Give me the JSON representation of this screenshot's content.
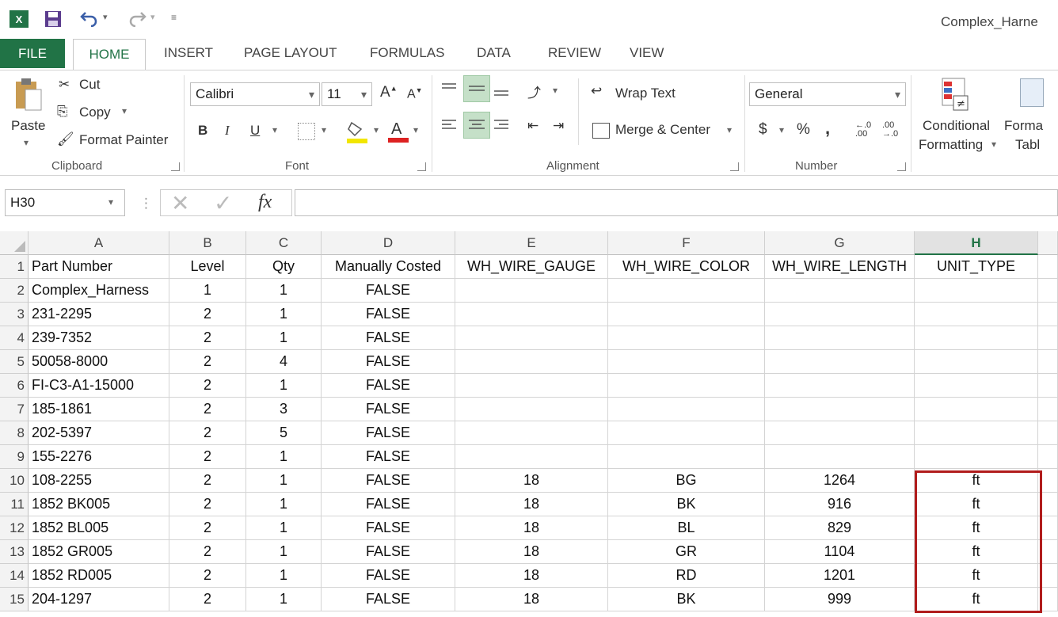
{
  "window": {
    "title": "Complex_Harne"
  },
  "quick_access": {
    "undo_icon": "undo-icon",
    "redo_icon": "redo-icon",
    "customize_icon": "customize-icon"
  },
  "tabs": [
    "FILE",
    "HOME",
    "INSERT",
    "PAGE LAYOUT",
    "FORMULAS",
    "DATA",
    "REVIEW",
    "VIEW"
  ],
  "ribbon": {
    "clipboard": {
      "paste": "Paste",
      "cut": "Cut",
      "copy": "Copy",
      "format_painter": "Format Painter",
      "label": "Clipboard"
    },
    "font": {
      "name": "Calibri",
      "size": "11",
      "bold": "B",
      "italic": "I",
      "underline": "U",
      "label": "Font"
    },
    "alignment": {
      "wrap_text": "Wrap Text",
      "merge_center": "Merge & Center",
      "label": "Alignment"
    },
    "number": {
      "format": "General",
      "currency": "$",
      "percent": "%",
      "comma": ",",
      "label": "Number"
    },
    "styles": {
      "conditional_line1": "Conditional",
      "conditional_line2": "Formatting",
      "format_line1": "Forma",
      "format_line2": "Tabl"
    }
  },
  "formula_bar": {
    "name_box": "H30",
    "fx": "fx",
    "value": ""
  },
  "columns": [
    "A",
    "B",
    "C",
    "D",
    "E",
    "F",
    "G",
    "H"
  ],
  "selected_column": "H",
  "headers": [
    "Part Number",
    "Level",
    "Qty",
    "Manually Costed",
    "WH_WIRE_GAUGE",
    "WH_WIRE_COLOR",
    "WH_WIRE_LENGTH",
    "UNIT_TYPE"
  ],
  "rows": [
    [
      "Complex_Harness",
      "1",
      "1",
      "FALSE",
      "",
      "",
      "",
      ""
    ],
    [
      "231-2295",
      "2",
      "1",
      "FALSE",
      "",
      "",
      "",
      ""
    ],
    [
      "239-7352",
      "2",
      "1",
      "FALSE",
      "",
      "",
      "",
      ""
    ],
    [
      "50058-8000",
      "2",
      "4",
      "FALSE",
      "",
      "",
      "",
      ""
    ],
    [
      "FI-C3-A1-15000",
      "2",
      "1",
      "FALSE",
      "",
      "",
      "",
      ""
    ],
    [
      "185-1861",
      "2",
      "3",
      "FALSE",
      "",
      "",
      "",
      ""
    ],
    [
      "202-5397",
      "2",
      "5",
      "FALSE",
      "",
      "",
      "",
      ""
    ],
    [
      "155-2276",
      "2",
      "1",
      "FALSE",
      "",
      "",
      "",
      ""
    ],
    [
      "108-2255",
      "2",
      "1",
      "FALSE",
      "18",
      "BG",
      "1264",
      "ft"
    ],
    [
      "1852 BK005",
      "2",
      "1",
      "FALSE",
      "18",
      "BK",
      "916",
      "ft"
    ],
    [
      "1852 BL005",
      "2",
      "1",
      "FALSE",
      "18",
      "BL",
      "829",
      "ft"
    ],
    [
      "1852 GR005",
      "2",
      "1",
      "FALSE",
      "18",
      "GR",
      "1104",
      "ft"
    ],
    [
      "1852 RD005",
      "2",
      "1",
      "FALSE",
      "18",
      "RD",
      "1201",
      "ft"
    ],
    [
      "204-1297",
      "2",
      "1",
      "FALSE",
      "18",
      "BK",
      "999",
      "ft"
    ]
  ],
  "colors": {
    "accent": "#217346",
    "highlight_box": "#b11c1c"
  }
}
